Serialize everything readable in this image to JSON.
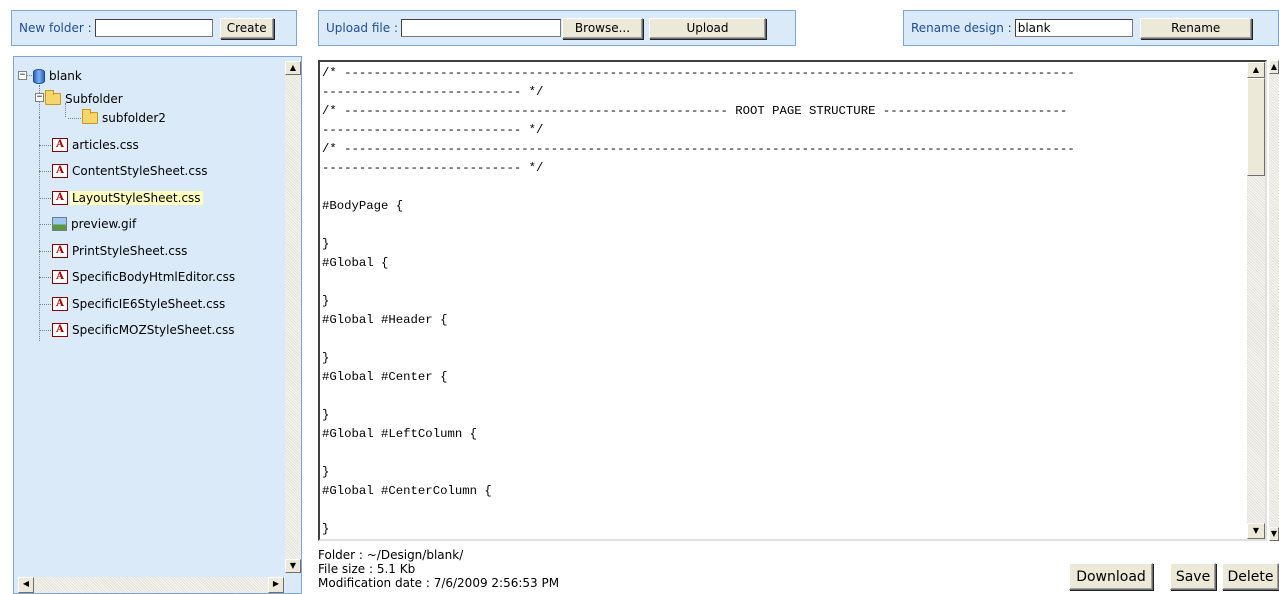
{
  "new_folder": {
    "label": "New folder :",
    "value": "",
    "button": "Create"
  },
  "upload": {
    "label": "Upload file :",
    "value": "",
    "browse_button": "Browse...",
    "upload_button": "Upload"
  },
  "rename": {
    "label": "Rename design :",
    "value": "blank",
    "button": "Rename"
  },
  "tree": {
    "root": "blank",
    "items": [
      {
        "label": "Subfolder",
        "icon": "folder-icon"
      },
      {
        "label": "subfolder2",
        "icon": "folder-icon"
      },
      {
        "label": "articles.css",
        "icon": "css-file-icon"
      },
      {
        "label": "ContentStyleSheet.css",
        "icon": "css-file-icon"
      },
      {
        "label": "LayoutStyleSheet.css",
        "icon": "css-file-icon",
        "selected": true
      },
      {
        "label": "preview.gif",
        "icon": "image-file-icon"
      },
      {
        "label": "PrintStyleSheet.css",
        "icon": "css-file-icon"
      },
      {
        "label": "SpecificBodyHtmlEditor.css",
        "icon": "css-file-icon"
      },
      {
        "label": "SpecificIE6StyleSheet.css",
        "icon": "css-file-icon"
      },
      {
        "label": "SpecificMOZStyleSheet.css",
        "icon": "css-file-icon"
      }
    ]
  },
  "editor": {
    "lines": [
      "/* ---------------------------------------------------------------------------------------------------",
      "--------------------------- */",
      "/* ---------------------------------------------------- ROOT PAGE STRUCTURE -------------------------",
      "--------------------------- */",
      "/* ---------------------------------------------------------------------------------------------------",
      "--------------------------- */",
      "",
      "#BodyPage {",
      "",
      "}",
      "#Global {",
      "",
      "}",
      "#Global #Header {",
      "",
      "}",
      "#Global #Center {",
      "",
      "}",
      "#Global #LeftColumn {",
      "",
      "}",
      "#Global #CenterColumn {",
      "",
      "}"
    ]
  },
  "file_info": {
    "folder": "Folder : ~/Design/blank/",
    "size": "File size : 5.1 Kb",
    "modified": "Modification date : 7/6/2009 2:56:53 PM"
  },
  "actions": {
    "download": "Download",
    "save": "Save",
    "delete": "Delete"
  }
}
